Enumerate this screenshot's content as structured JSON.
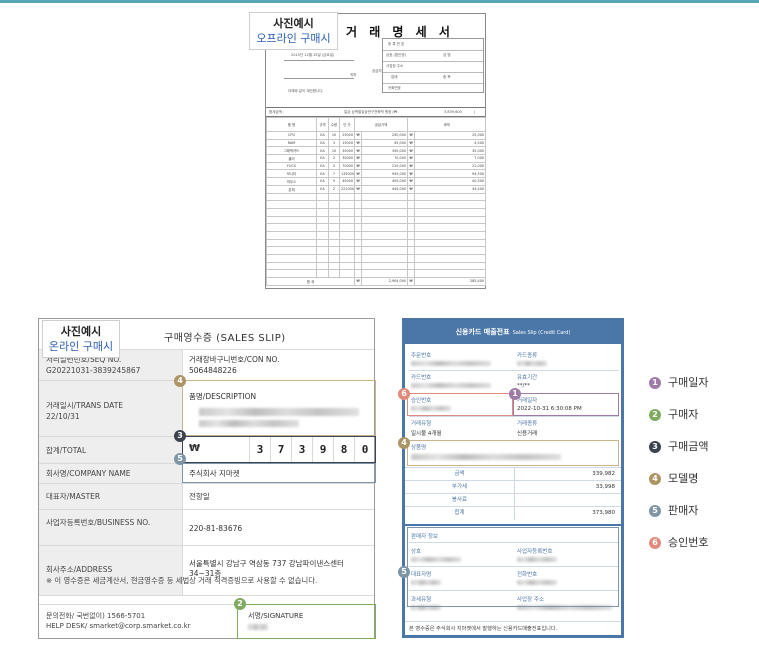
{
  "offline_tag": {
    "title": "사진예시",
    "subtitle": "오프라인 구매시"
  },
  "online_tag": {
    "title": "사진예시",
    "subtitle": "온라인 구매시"
  },
  "invoice": {
    "title": "거 래 명 세 서",
    "date_line": "2015년 12월 15일 (금요일)",
    "customer_suffix": "귀하",
    "note": "아래와 같이 계산합니다.",
    "supplier_labels": [
      "등 록 번 호",
      "상호 (법인명)",
      "사업장 주소",
      "업태",
      "전화번호"
    ],
    "supplier_side": "공급자",
    "name_label": "성 명",
    "item_label": "종 목",
    "total_label": "합계금액 :",
    "total_text": "일금 삼백팔십삼만구천육백 원정 (₩",
    "total_value": "3,839,600",
    "total_close": ")",
    "headers": [
      "품 명",
      "규격",
      "수량",
      "단 가",
      "공급가액",
      "세액"
    ],
    "rows": [
      [
        "CPU",
        "EA",
        "10",
        "25000",
        "₩",
        "250,000",
        "₩",
        "25,000"
      ],
      [
        "RAM",
        "EA",
        "3",
        "15000",
        "₩",
        "45,000",
        "₩",
        "4,500"
      ],
      [
        "그래픽카드",
        "EA",
        "10",
        "35000",
        "₩",
        "350,000",
        "₩",
        "35,000"
      ],
      [
        "쿨러",
        "EA",
        "2",
        "35000",
        "₩",
        "70,000",
        "₩",
        "7,000"
      ],
      [
        "FUCS",
        "EA",
        "3",
        "70000",
        "₩",
        "210,000",
        "₩",
        "21,000"
      ],
      [
        "모니터",
        "EA",
        "7",
        "135000",
        "₩",
        "945,000",
        "₩",
        "94,500"
      ],
      [
        "마우스",
        "EA",
        "9",
        "45000",
        "₩",
        "405,000",
        "₩",
        "40,500"
      ],
      [
        "본체",
        "EA",
        "2",
        "222000",
        "₩",
        "444,000",
        "₩",
        "44,400"
      ]
    ],
    "sum_label": "합 계",
    "sum_currency": "₩",
    "sum_supply": "2,904,000",
    "sum_tax": "285,400"
  },
  "receipt": {
    "header": "구매영수증 (SALES SLIP)",
    "seq_label": "처리일련번호/SEQ NO.",
    "seq_value": "G20221031-3839245867",
    "con_label": "거래장바구니번호/CON NO.",
    "con_value": "5064848226",
    "trans_label": "거래일시/TRANS DATE",
    "trans_value": "22/10/31",
    "desc_label": "품명/DESCRIPTION",
    "total_label": "합계/TOTAL",
    "currency": "₩",
    "amount_digits": [
      "3",
      "7",
      "3",
      "9",
      "8",
      "0"
    ],
    "company_label": "회사명/COMPANY NAME",
    "company_value": "주식회사 지마켓",
    "master_label": "대표자/MASTER",
    "master_value": "전항일",
    "biz_label": "사업자등록번호/BUSINESS NO.",
    "biz_value": "220-81-83676",
    "addr_label": "회사주소/ADDRESS",
    "addr_value": "서울특별시 강남구 역삼동 737 강남파이낸스센터 34~31층",
    "notice": "※ 이 영수증은 세금계산서, 현금영수증 등 세법상 거래 적격증빙으로 사용할 수 없습니다.",
    "help_phone": "문의전화/ 국번없이) 1566-5701",
    "help_desk": "HELP DESK/ smarket@corp.smarket.co.kr",
    "signature_label": "서명/SIGNATURE"
  },
  "card_slip": {
    "title": "신용카드 매출전표",
    "title_sub": "Sales Slip (Credit Card)",
    "card_no_label": "주문번호",
    "card_type_label": "카드종류",
    "card_num_label": "카드번호",
    "valid_label": "유효기간",
    "valid_value": "**/**",
    "approval_label": "승인번호",
    "trade_date_label": "거래일자",
    "trade_date_value": "2022-10-31 6:30:08 PM",
    "install_label": "거래유형",
    "install_value": "일시불 4개월",
    "trade_type_label": "거래종류",
    "trade_type_value": "신용거래",
    "product_label": "상품명",
    "amount_rows": [
      {
        "label": "금액",
        "value": "339,982"
      },
      {
        "label": "부가세",
        "value": "33,998"
      },
      {
        "label": "봉사료",
        "value": ""
      },
      {
        "label": "합계",
        "value": "373,980"
      }
    ],
    "seller_section": "판매자 정보",
    "seller_name_label": "상호",
    "seller_biz_label": "사업자등록번호",
    "seller_rep_label": "대표자명",
    "seller_phone_label": "전화번호",
    "seller_type_label": "과세유형",
    "seller_addr_label": "사업장 주소",
    "footer": "본 영수증은 주식회사 지마켓에서 발행하는 신용카드매출전표입니다."
  },
  "legend": [
    {
      "num": "1",
      "label": "구매일자",
      "color": "#a07aa8"
    },
    {
      "num": "2",
      "label": "구매자",
      "color": "#7fab5f"
    },
    {
      "num": "3",
      "label": "구매금액",
      "color": "#3b4350"
    },
    {
      "num": "4",
      "label": "모델명",
      "color": "#ad9464"
    },
    {
      "num": "5",
      "label": "판매자",
      "color": "#7e95a8"
    },
    {
      "num": "6",
      "label": "승인번호",
      "color": "#e28a7c"
    }
  ]
}
